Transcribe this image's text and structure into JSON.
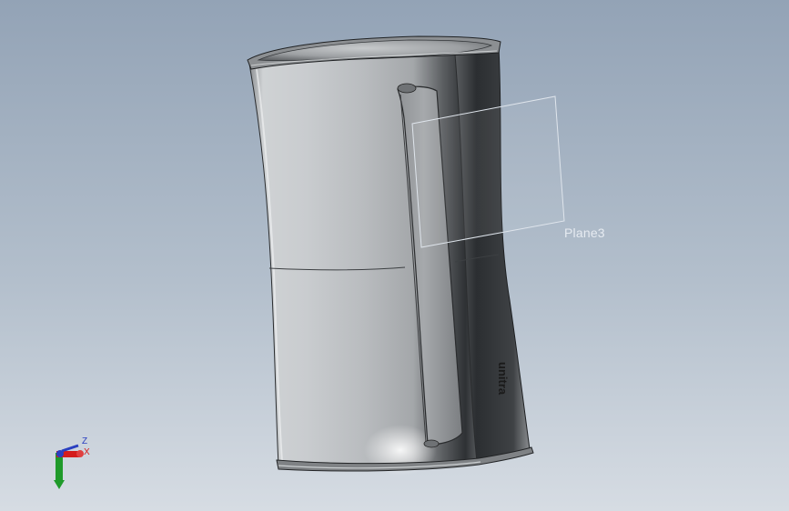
{
  "viewport": {
    "background_top": "#93a3b6",
    "background_bottom": "#d6dce3"
  },
  "model": {
    "brand_text": "unitra",
    "body_color": "#bfc2c4",
    "shadow_color": "#3a3d40"
  },
  "plane": {
    "label": "Plane3",
    "edge_color": "#dfe5ec"
  },
  "triad": {
    "z_label": "Z",
    "x_label": "X",
    "x_color": "#d41c1c",
    "y_color": "#1f9a2a",
    "z_color": "#2a3fc0"
  }
}
